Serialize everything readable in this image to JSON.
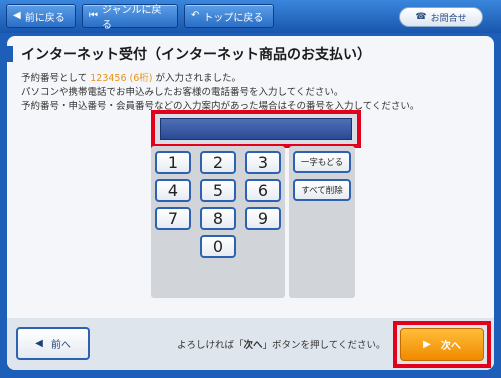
{
  "topbar": {
    "back_label": "前に戻る",
    "genre_label": "ジャンルに戻る",
    "top_label": "トップに戻る",
    "inquiry_label": "お問合せ"
  },
  "page": {
    "title": "インターネット受付（インターネット商品のお支払い）",
    "line1_prefix": "予約番号として",
    "line1_number": "123456",
    "line1_digits": "(6桁)",
    "line1_suffix": "が入力されました。",
    "line2": "パソコンや携帯電話でお申込みしたお客様の電話番号を入力してください。",
    "line3": "予約番号・申込番号・会員番号などの入力案内があった場合はその番号を入力してください。"
  },
  "display": {
    "value": ""
  },
  "keypad": {
    "keys": [
      "1",
      "2",
      "3",
      "4",
      "5",
      "6",
      "7",
      "8",
      "9",
      "0"
    ],
    "backspace_label": "一字もどる",
    "clear_label": "すべて削除"
  },
  "footer": {
    "back_label": "前へ",
    "confirm_prefix": "よろしければ「",
    "confirm_emphasis": "次へ",
    "confirm_suffix": "」ボタンを押してください。",
    "next_label": "次へ"
  },
  "colors": {
    "brand_blue": "#1d5fb8",
    "highlight_red": "#e2001a",
    "next_orange": "#f08a00",
    "number_orange": "#e8931a"
  }
}
